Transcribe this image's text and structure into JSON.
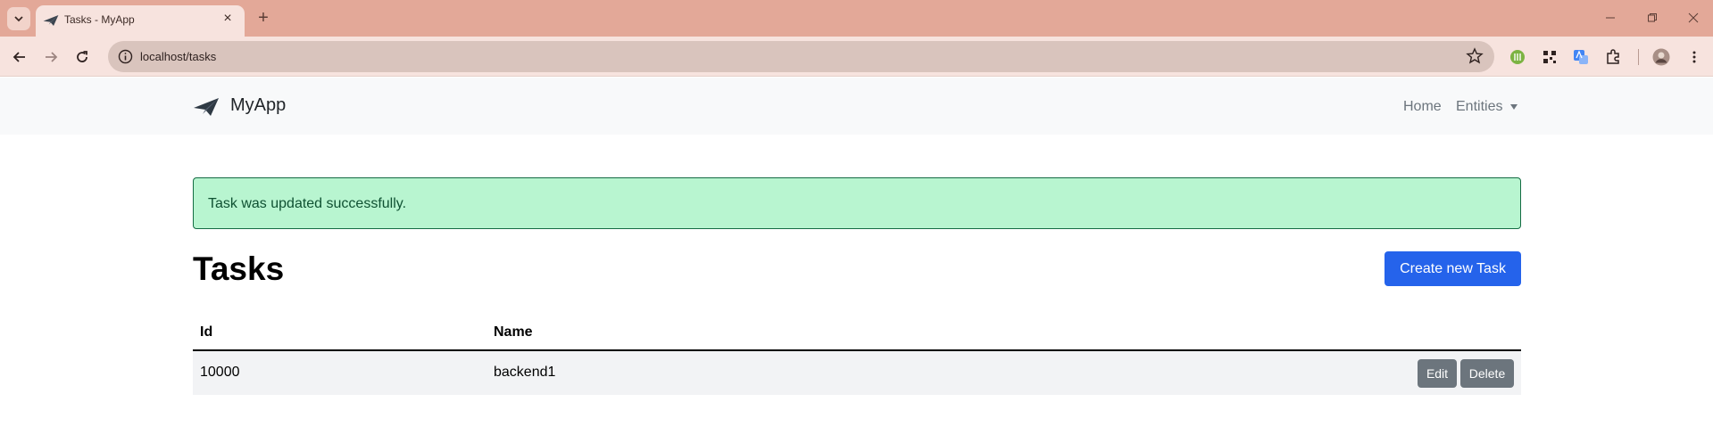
{
  "browser": {
    "tab_title": "Tasks - MyApp",
    "url": "localhost/tasks"
  },
  "navbar": {
    "brand": "MyApp",
    "links": [
      "Home",
      "Entities"
    ]
  },
  "alert": {
    "message": "Task was updated successfully."
  },
  "page": {
    "title": "Tasks",
    "create_button": "Create new Task"
  },
  "table": {
    "headers": [
      "Id",
      "Name"
    ],
    "rows": [
      {
        "id": "10000",
        "name": "backend1",
        "edit": "Edit",
        "delete": "Delete"
      }
    ]
  },
  "colors": {
    "primary": "#2563eb",
    "alert_bg": "#b8f5d0",
    "alert_text": "#0f5132",
    "secondary": "#6c757d",
    "chrome": "#e3a898"
  }
}
